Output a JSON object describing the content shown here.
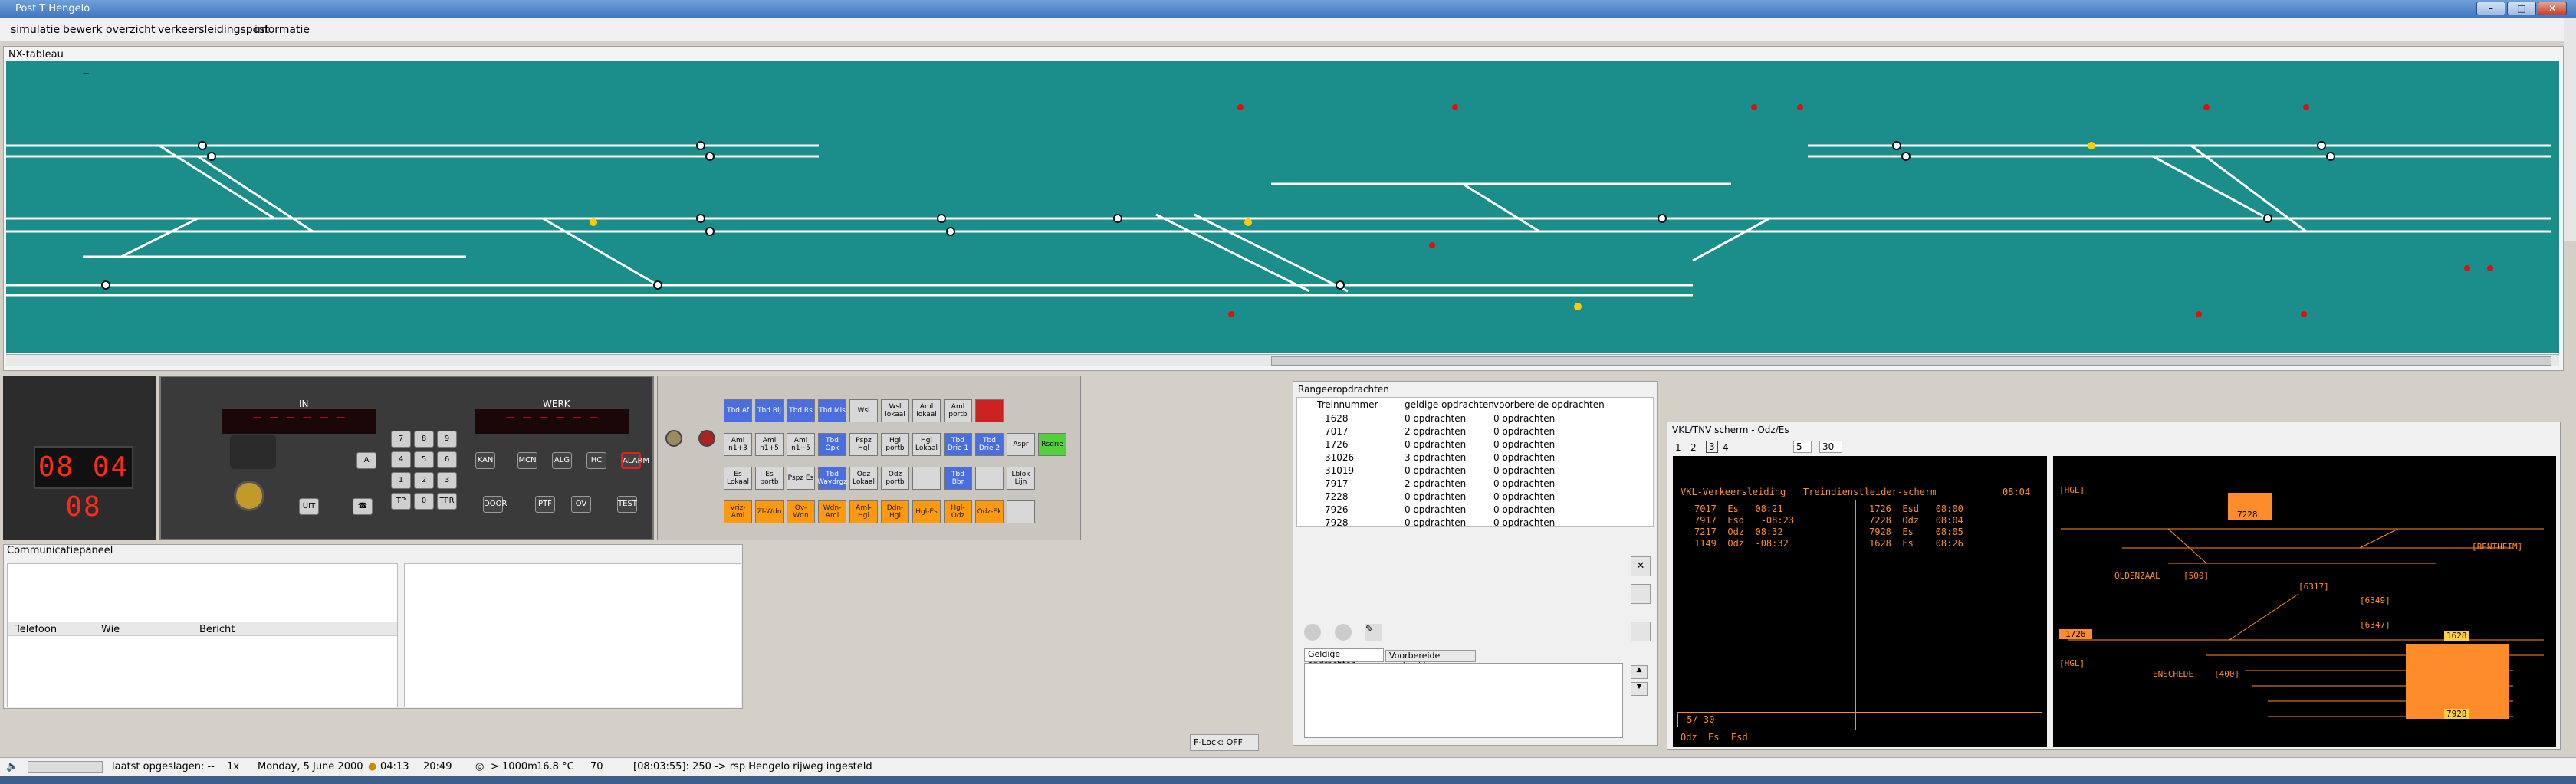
{
  "window": {
    "title": "Post T Hengelo"
  },
  "menu": [
    "simulatie",
    "bewerk",
    "overzicht",
    "verkeersleidingspost",
    "informatie"
  ],
  "nx": {
    "title": "NX-tableau"
  },
  "clock": {
    "display": "08 04 08"
  },
  "instrument": {
    "in_label": "IN",
    "werk_label": "WERK",
    "keys": [
      "7",
      "8",
      "9",
      "4",
      "5",
      "6",
      "1",
      "2",
      "3",
      "TP",
      "0",
      "TPR"
    ],
    "buttons": [
      "KAN",
      "MCN",
      "ALG",
      "HC",
      "ALARM",
      "UIT",
      "DOOR",
      "PTF",
      "OV",
      "TEST",
      "A"
    ]
  },
  "commands": {
    "row1": [
      "Tbd Af",
      "Tbd Bij",
      "Tbd Rs",
      "Tbd Mis",
      "Wsl",
      "Wsl lokaal",
      "Aml lokaal",
      "Aml portb",
      ""
    ],
    "row2": [
      "Aml n1+3",
      "Aml n1+5",
      "Aml n1+5",
      "Tbd Opk",
      "Pspz Hgl",
      "Hgl portb",
      "Hgl Lokaal",
      "Tbd Drie 1",
      "Tbd Drie 2",
      "Aspr",
      "Rsdrie"
    ],
    "row3": [
      "Es Lokaal",
      "Es portb",
      "Pspz Es",
      "Tbd Wavdrgz",
      "Odz Lokaal",
      "Odz portb",
      "",
      "Tbd Bbr",
      "",
      "Lblok Lijn"
    ],
    "row4": [
      "Vriz-Aml",
      "Zl-Wdn",
      "Ov-Wdn",
      "Wdn-Aml",
      "Aml-Hgl",
      "Ddn-Hgl",
      "Hgl-Es",
      "Hgl-Odz",
      "Odz-Ek",
      ""
    ]
  },
  "comm": {
    "title": "Communicatiepaneel",
    "columns": [
      "Telefoon",
      "Wie",
      "Bericht"
    ]
  },
  "rangeer": {
    "title": "Rangeeropdrachten",
    "columns": [
      "Treinnummer",
      "geldige opdrachten",
      "voorbereide opdrachten"
    ],
    "rows": [
      [
        "1628",
        "0 opdrachten",
        "0 opdrachten"
      ],
      [
        "7017",
        "2 opdrachten",
        "0 opdrachten"
      ],
      [
        "1726",
        "0 opdrachten",
        "0 opdrachten"
      ],
      [
        "31026",
        "3 opdrachten",
        "0 opdrachten"
      ],
      [
        "31019",
        "0 opdrachten",
        "0 opdrachten"
      ],
      [
        "7917",
        "2 opdrachten",
        "0 opdrachten"
      ],
      [
        "7228",
        "0 opdrachten",
        "0 opdrachten"
      ],
      [
        "7926",
        "0 opdrachten",
        "0 opdrachten"
      ],
      [
        "7928",
        "0 opdrachten",
        "0 opdrachten"
      ]
    ],
    "tabs": [
      "Geldige opdrachten",
      "Voorbereide opdrachten"
    ]
  },
  "tnv": {
    "title": "VKL/TNV scherm - Odz/Es",
    "tabs": [
      "1",
      "2",
      "3",
      "4"
    ],
    "spin1": "5",
    "spin2": "30",
    "term_header_left": "VKL-Verkeersleiding",
    "term_header_mid": "Treindienstleider-scherm",
    "term_header_time": "08:04",
    "left_rows": [
      "7017  Es   08:21",
      "7917  Esd   -08:23",
      "7217  Odz  08:32",
      "1149  Odz  -08:32"
    ],
    "right_rows": [
      "1726  Esd   08:00",
      "7228  Odz   08:04",
      "7928  Es    08:05",
      "1628  Es    08:26"
    ],
    "input": "+5/-30",
    "footer": [
      "Odz",
      "Es",
      "Esd"
    ],
    "map": {
      "hgl": "[HGL]",
      "bentheim": "[BENTHEIM]",
      "oldenzaal": "OLDENZAAL",
      "code500": "[500]",
      "enschede": "ENSCHEDE",
      "code400": "[400]",
      "t1": "7228",
      "t2": "1726",
      "t3": "1628",
      "t4": "7928",
      "c1": "[6317]",
      "c2": "[6349]",
      "c3": "[6347]"
    }
  },
  "status": {
    "saved": "laatst opgeslagen:  --",
    "speed": "1x",
    "date": "Monday, 5 June 2000",
    "sunrise": "04:13",
    "sunset": "20:49",
    "visibility": "> 1000m",
    "temp": "16.8 °C",
    "count": "70",
    "message": "[08:03:55]: 250 -> rsp Hengelo rijweg ingesteld",
    "flock": "F-Lock: OFF"
  }
}
